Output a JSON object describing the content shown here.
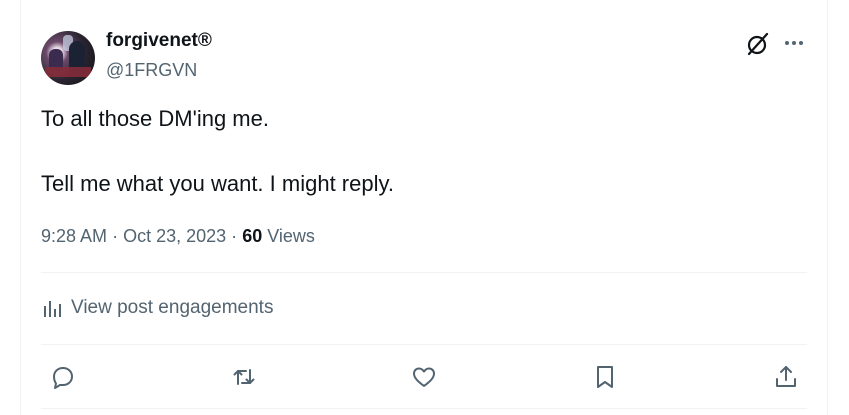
{
  "author": {
    "display_name": "forgivenet®",
    "handle": "@1FRGVN"
  },
  "tweet": {
    "line1": "To all those DM'ing me.",
    "line2": "Tell me what you want. I might reply."
  },
  "meta": {
    "time": "9:28 AM",
    "separator1": "·",
    "date": "Oct 23, 2023",
    "separator2": "·",
    "views_count": "60",
    "views_label": "Views"
  },
  "engagements": {
    "label": "View post engagements"
  },
  "icons": {
    "grok": "grok-icon",
    "more": "more-icon",
    "analytics": "analytics-icon",
    "reply": "reply-icon",
    "repost": "repost-icon",
    "like": "like-icon",
    "bookmark": "bookmark-icon",
    "share": "share-icon"
  },
  "colors": {
    "text_primary": "#0f1419",
    "text_secondary": "#536471",
    "divider": "#eff3f4"
  }
}
